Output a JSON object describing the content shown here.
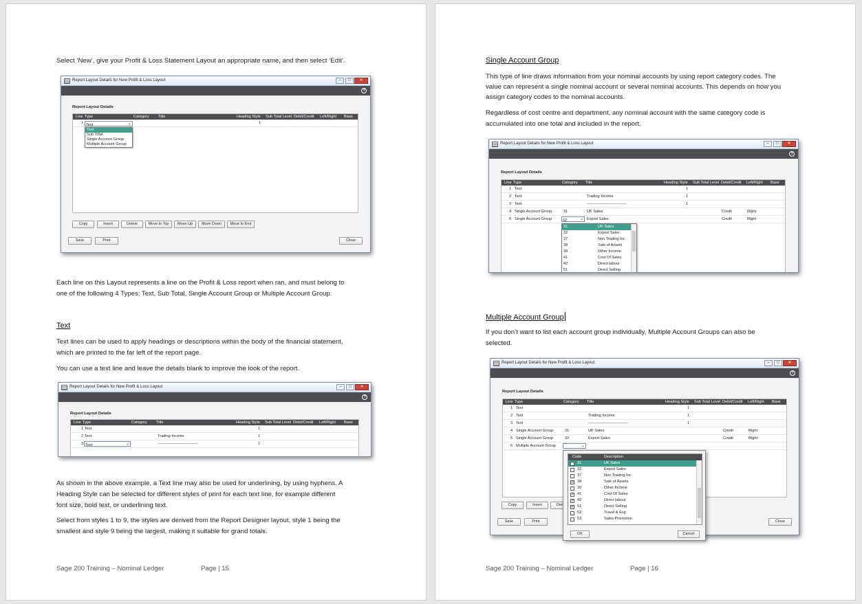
{
  "page_left": {
    "intro": "Select ‘New’, give your Profit & Loss Statement Layout an appropriate name, and then select ‘Edit’.",
    "types_para": [
      "Each line on this Layout represents a line on the Profit & Loss report when ran, and must belong to",
      "one of the following 4 Types; Text, Sub Total, Single Account Group or Multiple Account Group."
    ],
    "text_heading": "Text",
    "text_para1": [
      "Text lines can be used to apply headings or descriptions within the body of the financial statement,",
      "which are printed to the far left of the report page."
    ],
    "text_para2": "You can use a text line and leave the details blank to improve the look of the report.",
    "hyphen_para": [
      "As shown in the above example, a Text line may also be used for underlining, by using hyphens. A",
      "Heading Style can be selected for different styles of print for each text line, for example different",
      "font size, bold text, or underlining text."
    ],
    "styles_para": [
      "Select from styles 1 to 9, the styles are derived from the Report Designer layout, style 1 being the",
      "smallest and style 9 being the largest, making it suitable for grand totals."
    ],
    "footer_title": "Sage 200 Training – Nominal Ledger",
    "footer_page": "Page | 15"
  },
  "page_right": {
    "single_heading": "Single Account Group",
    "single_para1": [
      "This type of line draws information from your nominal accounts by using report category codes. The",
      "value can represent a single nominal account or several nominal accounts. This depends on how you",
      "assign category codes to the nominal accounts."
    ],
    "single_para2": [
      "Regardless of cost centre and department, any nominal account with the same category code is",
      "accumulated into one total and included in the report."
    ],
    "multi_heading": "Multiple Account Group",
    "multi_para": [
      "If you don’t want to list each account group individually, Multiple Account Groups can also be",
      "selected."
    ],
    "footer_title": "Sage 200 Training – Nominal Ledger",
    "footer_page": "Page | 16"
  },
  "dialog": {
    "title": "Report Layout Details for New Profit & Loss Layout",
    "section": "Report Layout Details",
    "help": "?",
    "columns": [
      "Line",
      "Type",
      "Category",
      "Title",
      "Heading Style",
      "Sub Total Level",
      "Debit/Credit",
      "Left/Right",
      "Base"
    ],
    "buttons": [
      "Copy",
      "Insert",
      "Delete",
      "Move to Top",
      "Move Up",
      "Move Down",
      "Move to End"
    ],
    "save": "Save",
    "print": "Print",
    "close": "Close"
  },
  "dialog1": {
    "row": {
      "line": "1",
      "type": "Text",
      "style": "1"
    },
    "type_options": [
      "Text",
      "Sub Total",
      "Single Account Group",
      "Multiple Account Group"
    ],
    "type_selected": "Text"
  },
  "dialog2": {
    "rows": [
      {
        "line": "1",
        "type": "Text",
        "title": "",
        "style": "1"
      },
      {
        "line": "2",
        "type": "Text",
        "title": "Trading Income",
        "style": "1"
      },
      {
        "line": "3",
        "type": "Text",
        "title": "-------------------------------",
        "style": "1"
      }
    ]
  },
  "dialog3": {
    "rows": [
      {
        "line": "1",
        "type": "Text",
        "cat": "",
        "title": "",
        "style": "1",
        "dc": "",
        "lr": ""
      },
      {
        "line": "2",
        "type": "Text",
        "cat": "",
        "title": "Trading Income",
        "style": "1",
        "dc": "",
        "lr": ""
      },
      {
        "line": "3",
        "type": "Text",
        "cat": "",
        "title": "-------------------------------",
        "style": "1",
        "dc": "",
        "lr": ""
      },
      {
        "line": "4",
        "type": "Single Account Group",
        "cat": "31",
        "title": "UK Sales",
        "style": "",
        "dc": "Credit",
        "lr": "Right"
      },
      {
        "line": "5",
        "type": "Single Account Group",
        "cat": "32",
        "title": "Export Sales",
        "style": "",
        "dc": "Credit",
        "lr": "Right"
      }
    ],
    "categories": [
      {
        "code": "31",
        "desc": "UK Sales"
      },
      {
        "code": "32",
        "desc": "Export Sales"
      },
      {
        "code": "37",
        "desc": "Non Trading Inc"
      },
      {
        "code": "38",
        "desc": "Sale of Assets"
      },
      {
        "code": "39",
        "desc": "Other Income"
      },
      {
        "code": "41",
        "desc": "Cost Of Sales"
      },
      {
        "code": "42",
        "desc": "Direct labour"
      },
      {
        "code": "51",
        "desc": "Direct Selling"
      }
    ]
  },
  "dialog4": {
    "rows": [
      {
        "line": "1",
        "type": "Text",
        "cat": "",
        "title": "",
        "style": "1",
        "dc": "",
        "lr": ""
      },
      {
        "line": "2",
        "type": "Text",
        "cat": "",
        "title": "Trading Income",
        "style": "1",
        "dc": "",
        "lr": ""
      },
      {
        "line": "3",
        "type": "Text",
        "cat": "",
        "title": "-------------------------------",
        "style": "1",
        "dc": "",
        "lr": ""
      },
      {
        "line": "4",
        "type": "Single Account Group",
        "cat": "31",
        "title": "UK Sales",
        "style": "",
        "dc": "Credit",
        "lr": "Right"
      },
      {
        "line": "5",
        "type": "Single Account Group",
        "cat": "32",
        "title": "Export Sales",
        "style": "",
        "dc": "Credit",
        "lr": "Right"
      },
      {
        "line": "6",
        "type": "Multiple Account Group",
        "cat": "",
        "title": "",
        "style": "",
        "dc": "",
        "lr": ""
      }
    ],
    "picker_headers": [
      "Code",
      "Description"
    ],
    "picker_items": [
      {
        "code": "31",
        "desc": "UK Sales",
        "checked": false
      },
      {
        "code": "32",
        "desc": "Export Sales",
        "checked": false
      },
      {
        "code": "37",
        "desc": "Non Trading Inc",
        "checked": false
      },
      {
        "code": "38",
        "desc": "Sale of Assets",
        "checked": true
      },
      {
        "code": "39",
        "desc": "Other Income",
        "checked": false
      },
      {
        "code": "41",
        "desc": "Cost Of Sales",
        "checked": true
      },
      {
        "code": "42",
        "desc": "Direct labour",
        "checked": true
      },
      {
        "code": "51",
        "desc": "Direct Selling",
        "checked": true
      },
      {
        "code": "52",
        "desc": "Travel & Exp",
        "checked": false
      },
      {
        "code": "53",
        "desc": "Sales Promotion",
        "checked": false
      }
    ],
    "ok": "OK",
    "cancel": "Cancel",
    "delete_partial": "Dele"
  }
}
